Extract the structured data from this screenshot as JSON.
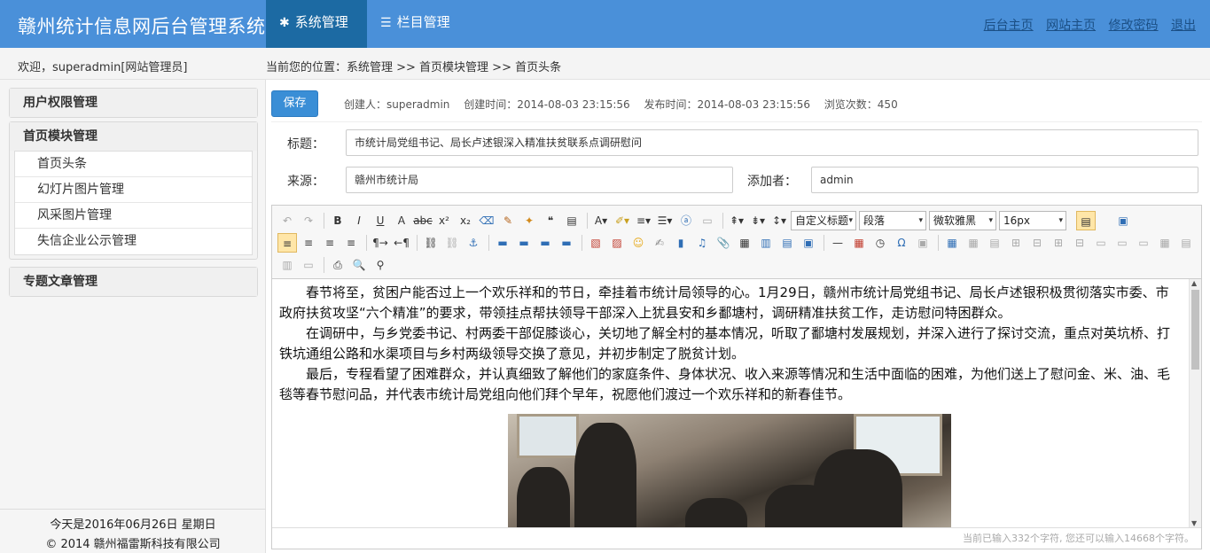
{
  "header": {
    "title": "赣州统计信息网后台管理系统",
    "tabs": [
      {
        "label": "系统管理",
        "icon": "gear-icon"
      },
      {
        "label": "栏目管理",
        "icon": "list-icon"
      }
    ],
    "links": [
      "后台主页",
      "网站主页",
      "修改密码",
      "退出"
    ]
  },
  "subheader": {
    "welcome": "欢迎，superadmin[网站管理员]",
    "location": "当前您的位置：系统管理 >> 首页模块管理 >> 首页头条"
  },
  "sidebar": {
    "sections": [
      {
        "title": "用户权限管理"
      },
      {
        "title": "首页模块管理",
        "items": [
          "首页头条",
          "幻灯片图片管理",
          "风采图片管理",
          "失信企业公示管理"
        ]
      },
      {
        "title": "专题文章管理"
      }
    ],
    "footer_date": "今天是2016年06月26日 星期日",
    "footer_copyright": "© 2014 赣州福雷斯科技有限公司"
  },
  "form": {
    "save_label": "保存",
    "creator": "创建人：superadmin",
    "created_time": "创建时间：2014-08-03 23:15:56",
    "publish_time": "发布时间：2014-08-03 23:15:56",
    "views": "浏览次数：450",
    "title_label": "标题：",
    "title_value": "市统计局党组书记、局长卢述银深入精准扶贫联系点调研慰问",
    "source_label": "来源：",
    "source_value": "赣州市统计局",
    "adder_label": "添加者：",
    "adder_value": "admin"
  },
  "editor": {
    "selects": {
      "custom_title": "自定义标题",
      "paragraph": "段落",
      "font_family": "微软雅黑",
      "font_size": "16px"
    },
    "paragraphs": [
      "春节将至，贫困户能否过上一个欢乐祥和的节日，牵挂着市统计局领导的心。1月29日，赣州市统计局党组书记、局长卢述银积极贯彻落实市委、市政府扶贫攻坚“六个精准”的要求，带领挂点帮扶领导干部深入上犹县安和乡鄱塘村，调研精准扶贫工作，走访慰问特困群众。",
      "在调研中，与乡党委书记、村两委干部促膝谈心，关切地了解全村的基本情况，听取了鄱塘村发展规划，并深入进行了探讨交流，重点对英坑桥、打铁坑通组公路和水渠项目与乡村两级领导交换了意见，并初步制定了脱贫计划。",
      "最后，专程看望了困难群众，并认真细致了解他们的家庭条件、身体状况、收入来源等情况和生活中面临的困难，为他们送上了慰问金、米、油、毛毯等春节慰问品，并代表市统计局党组向他们拜个早年，祝愿他们渡过一个欢乐祥和的新春佳节。"
    ],
    "status": "当前已输入332个字符, 您还可以输入14668个字符。"
  }
}
